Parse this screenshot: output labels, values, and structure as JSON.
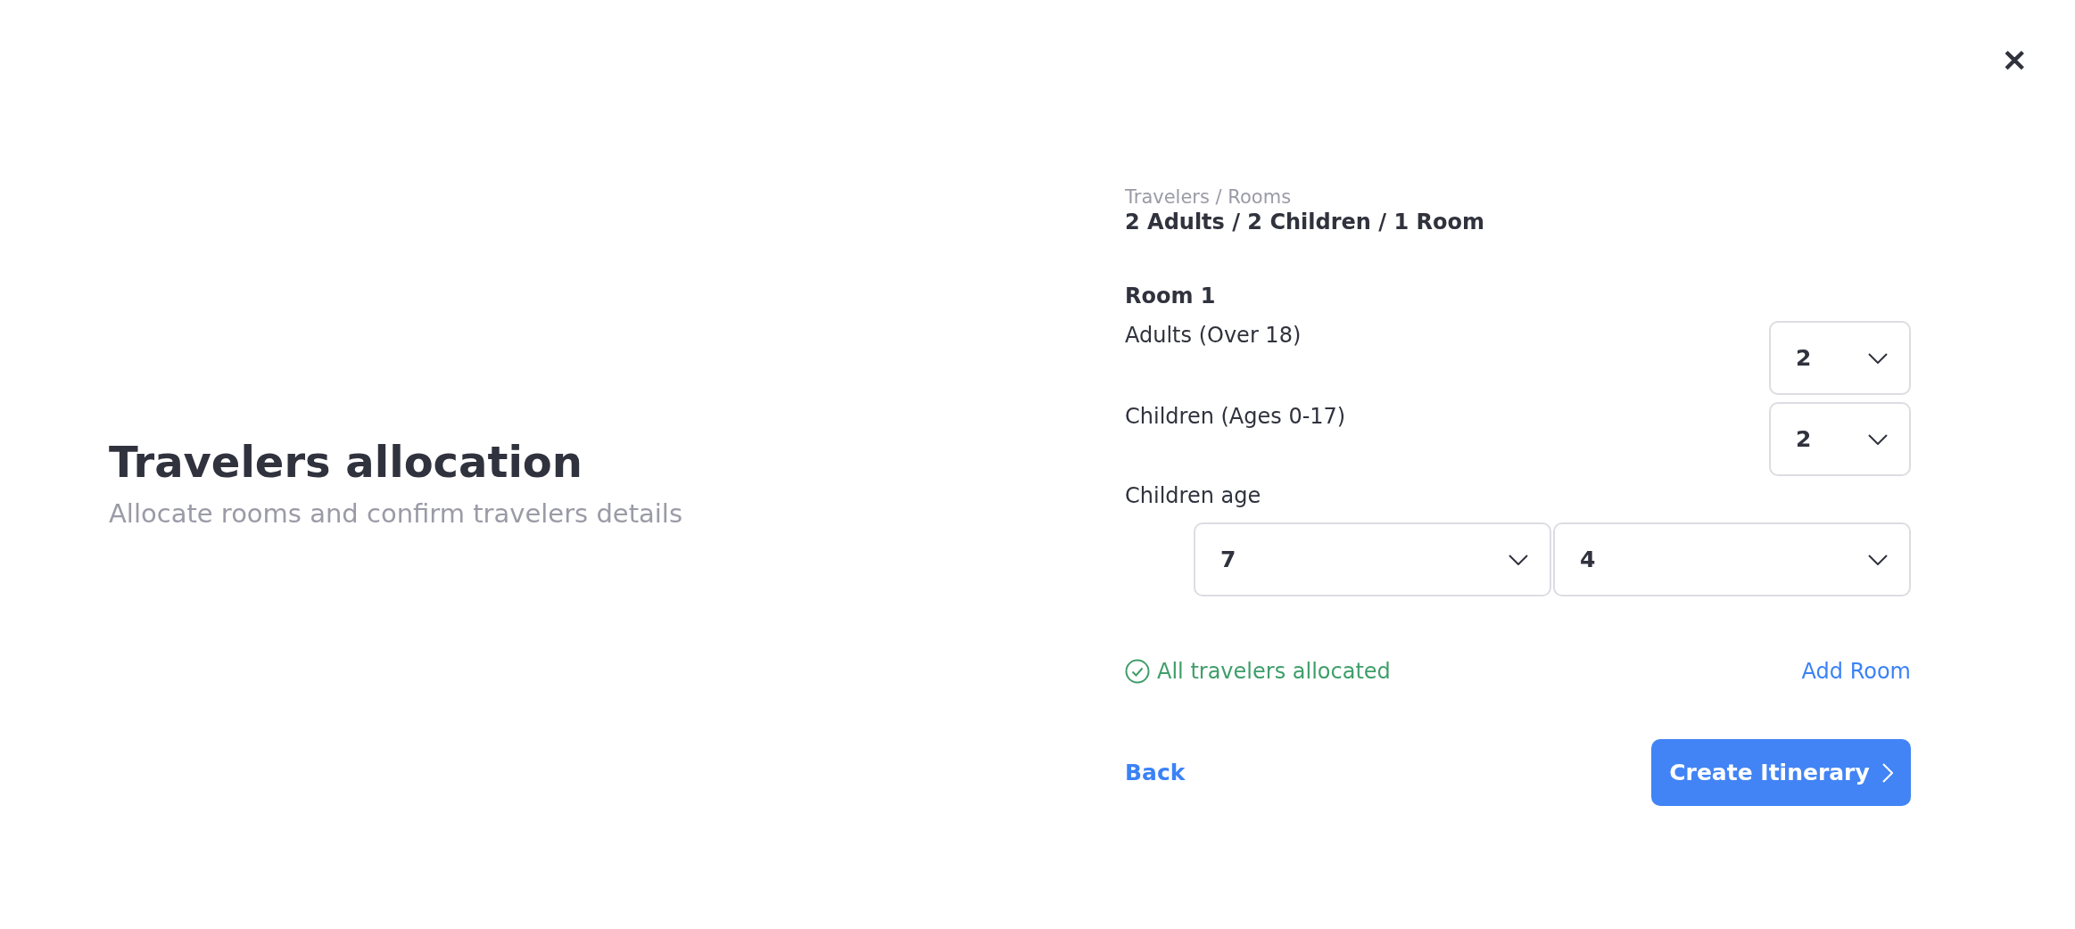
{
  "close_button": {
    "label": "✕"
  },
  "intro": {
    "title": "Travelers allocation",
    "subtitle": "Allocate rooms and confirm travelers details"
  },
  "summary": {
    "label": "Travelers / Rooms",
    "value": "2 Adults / 2 Children / 1 Room"
  },
  "rooms": [
    {
      "title": "Room 1",
      "counts": [
        {
          "label": "Adults (Over 18)",
          "value": "2"
        },
        {
          "label": "Children (Ages 0-17)",
          "value": "2"
        }
      ],
      "children_age": {
        "label": "Children age",
        "ages": [
          "7",
          "4"
        ]
      }
    }
  ],
  "status": {
    "text": "All travelers allocated",
    "ok": true
  },
  "add_room": "Add Room",
  "back": "Back",
  "submit": "Create Itinerary"
}
